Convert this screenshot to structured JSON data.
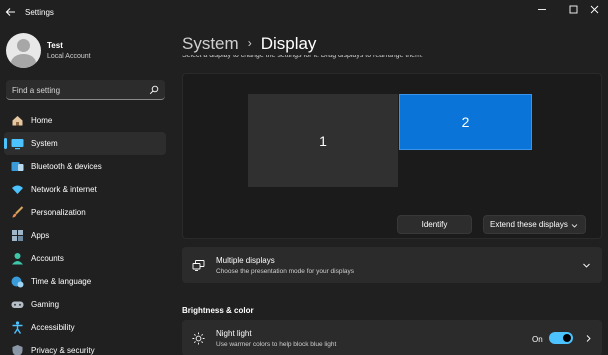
{
  "window": {
    "title": "Settings"
  },
  "profile": {
    "name": "Test",
    "account_type": "Local Account"
  },
  "search": {
    "placeholder": "Find a setting"
  },
  "sidebar": {
    "items": [
      {
        "label": "Home",
        "icon": "home-icon",
        "active": false
      },
      {
        "label": "System",
        "icon": "system-icon",
        "active": true
      },
      {
        "label": "Bluetooth & devices",
        "icon": "bluetooth-icon",
        "active": false
      },
      {
        "label": "Network & internet",
        "icon": "wifi-icon",
        "active": false
      },
      {
        "label": "Personalization",
        "icon": "brush-icon",
        "active": false
      },
      {
        "label": "Apps",
        "icon": "apps-icon",
        "active": false
      },
      {
        "label": "Accounts",
        "icon": "person-icon",
        "active": false
      },
      {
        "label": "Time & language",
        "icon": "globe-clock-icon",
        "active": false
      },
      {
        "label": "Gaming",
        "icon": "gamepad-icon",
        "active": false
      },
      {
        "label": "Accessibility",
        "icon": "accessibility-icon",
        "active": false
      },
      {
        "label": "Privacy & security",
        "icon": "shield-icon",
        "active": false
      }
    ]
  },
  "breadcrumb": {
    "root": "System",
    "separator": "›",
    "page": "Display"
  },
  "hint": "Select a display to change the settings for it. Drag displays to rearrange them.",
  "displays": {
    "monitors": [
      {
        "label": "1",
        "selected": false
      },
      {
        "label": "2",
        "selected": true
      }
    ],
    "identify_label": "Identify",
    "mode_label": "Extend these displays"
  },
  "multiple_displays": {
    "title": "Multiple displays",
    "subtitle": "Choose the presentation mode for your displays"
  },
  "brightness_section": {
    "label": "Brightness & color"
  },
  "night_light": {
    "title": "Night light",
    "subtitle": "Use warmer colors to help block blue light",
    "state_label": "On",
    "enabled": true
  },
  "colors": {
    "background": "#202020",
    "card": "#2b2b2b",
    "accent": "#4cc2ff",
    "selected_monitor": "#0a74d8"
  }
}
